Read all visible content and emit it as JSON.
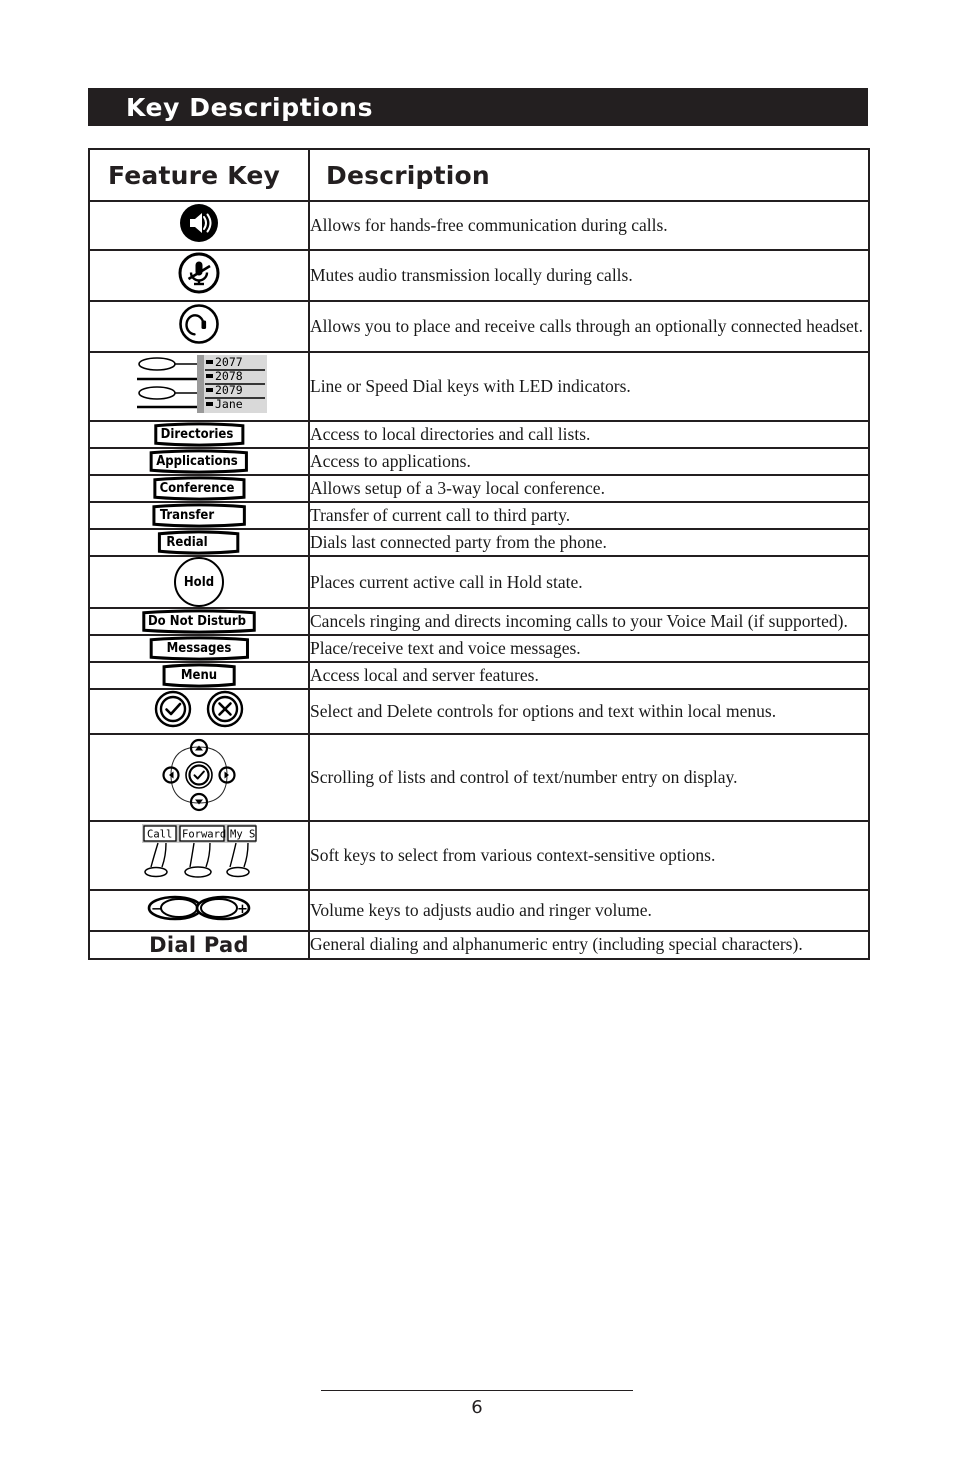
{
  "page": {
    "banner_title": "Key Descriptions",
    "page_number": "6"
  },
  "table": {
    "headers": {
      "feature_key": "Feature Key",
      "description": "Description"
    },
    "rows": [
      {
        "key_type": "icon",
        "icon": "speakerphone-icon",
        "key_label": "",
        "description": "Allows for hands-free communication during calls."
      },
      {
        "key_type": "icon",
        "icon": "mute-icon",
        "key_label": "",
        "description": "Mutes audio transmission locally during calls."
      },
      {
        "key_type": "icon",
        "icon": "headset-icon",
        "key_label": "",
        "description": "Allows you to place and receive calls through an optionally connected headset."
      },
      {
        "key_type": "linekeys",
        "icon": "line-keys-display-icon",
        "key_label": "",
        "description": "Line or Speed Dial keys with LED indicators."
      },
      {
        "key_type": "lenskey",
        "icon": "directories-key-icon",
        "key_label": "Directories",
        "description": "Access to local directories and call lists."
      },
      {
        "key_type": "lenskey",
        "icon": "applications-key-icon",
        "key_label": "Applications",
        "description": "Access to applications."
      },
      {
        "key_type": "lenskey",
        "icon": "conference-key-icon",
        "key_label": "Conference",
        "description": "Allows setup of a 3-way local conference."
      },
      {
        "key_type": "lenskey",
        "icon": "transfer-key-icon",
        "key_label": "Transfer",
        "description": "Transfer of current call to third party."
      },
      {
        "key_type": "lenskey",
        "icon": "redial-key-icon",
        "key_label": "Redial",
        "description": "Dials last connected party from the phone."
      },
      {
        "key_type": "roundkey",
        "icon": "hold-key-icon",
        "key_label": "Hold",
        "description": "Places current active call in Hold state."
      },
      {
        "key_type": "lenskey",
        "icon": "do-not-disturb-key-icon",
        "key_label": "Do Not Disturb",
        "description": "Cancels ringing and directs incoming calls to your Voice Mail (if supported)."
      },
      {
        "key_type": "lenskey",
        "icon": "messages-key-icon",
        "key_label": "Messages",
        "description": "Place/receive text and voice messages."
      },
      {
        "key_type": "lenskey",
        "icon": "menu-key-icon",
        "key_label": "Menu",
        "description": "Access local and server features."
      },
      {
        "key_type": "icon-pair",
        "icon": "select-delete-icons",
        "key_label": "",
        "description": "Select and Delete controls for options and text within local menus."
      },
      {
        "key_type": "navcluster",
        "icon": "navigation-cluster-icon",
        "key_label": "",
        "description": "Scrolling of lists and control of text/number entry on display."
      },
      {
        "key_type": "softkeys",
        "icon": "soft-keys-icon",
        "key_label": "",
        "description": "Soft keys to select from various context-sensitive options."
      },
      {
        "key_type": "icon",
        "icon": "volume-keys-icon",
        "key_label": "",
        "description": "Volume keys to adjusts audio and ringer volume."
      },
      {
        "key_type": "text",
        "icon": "",
        "key_label": "Dial Pad",
        "description": "General dialing and alphanumeric entry (including special characters)."
      }
    ]
  },
  "line_keys_display": {
    "entries": [
      "2077",
      "2078",
      "2079",
      "Jane"
    ]
  },
  "soft_keys": {
    "labels": [
      "Call",
      "Forward",
      "My S"
    ]
  },
  "volume_keys": {
    "minus": "−",
    "plus": "+"
  },
  "colors": {
    "banner_background": "#231f20",
    "banner_text": "#ffffff",
    "border": "#231f20",
    "text": "#1a1a1a",
    "lcd_background": "#d9d9d9"
  }
}
